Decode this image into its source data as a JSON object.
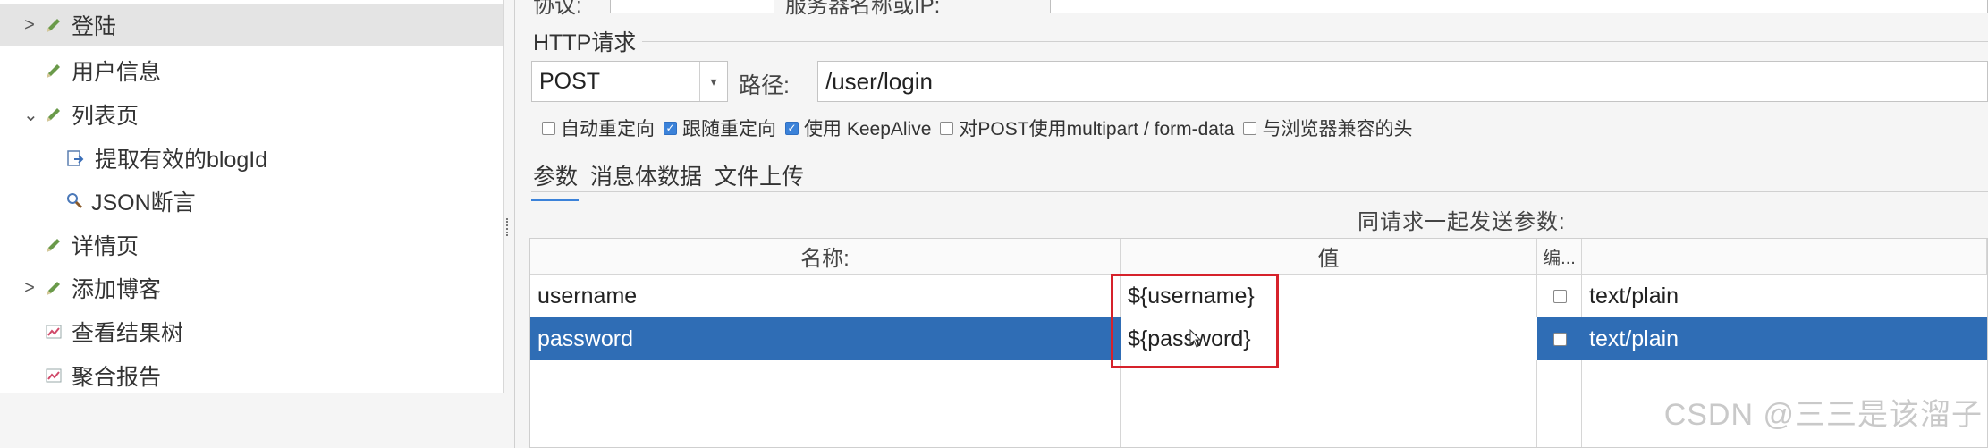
{
  "tree": {
    "items": [
      {
        "label": "登陆",
        "chevron": ">",
        "icon": "pencil-icon",
        "selected": true
      },
      {
        "label": "用户信息",
        "chevron": "",
        "icon": "pencil-icon",
        "selected": false
      },
      {
        "label": "列表页",
        "chevron": "⌄",
        "icon": "pencil-icon",
        "selected": false
      },
      {
        "label": "提取有效的blogId",
        "chevron": "",
        "icon": "extractor-icon",
        "selected": false
      },
      {
        "label": "JSON断言",
        "chevron": "",
        "icon": "magnifier-icon",
        "selected": false
      },
      {
        "label": "详情页",
        "chevron": "",
        "icon": "pencil-icon",
        "selected": false
      },
      {
        "label": "添加博客",
        "chevron": ">",
        "icon": "pencil-icon",
        "selected": false
      },
      {
        "label": "查看结果树",
        "chevron": "",
        "icon": "chart-icon",
        "selected": false
      },
      {
        "label": "聚合报告",
        "chevron": "",
        "icon": "chart-icon",
        "selected": false
      }
    ]
  },
  "top": {
    "protocol_label": "协议:",
    "server_label": "服务器名称或IP:"
  },
  "http": {
    "section_title": "HTTP请求",
    "method": "POST",
    "path_label": "路径:",
    "path_value": "/user/login",
    "options": [
      {
        "label": "自动重定向",
        "checked": false
      },
      {
        "label": "跟随重定向",
        "checked": true
      },
      {
        "label": "使用 KeepAlive",
        "checked": true
      },
      {
        "label": "对POST使用multipart / form-data",
        "checked": false
      },
      {
        "label": "与浏览器兼容的头",
        "checked": false
      }
    ],
    "tabs": [
      {
        "label": "参数",
        "active": true
      },
      {
        "label": "消息体数据",
        "active": false
      },
      {
        "label": "文件上传",
        "active": false
      }
    ]
  },
  "params": {
    "caption": "同请求一起发送参数:",
    "headers": {
      "name": "名称:",
      "value": "值",
      "encode": "编...",
      "content_type": ""
    },
    "rows": [
      {
        "name": "username",
        "value": "${username}",
        "encode": false,
        "content_type": "text/plain",
        "selected": false
      },
      {
        "name": "password",
        "value": "${password}",
        "encode": false,
        "content_type": "text/plain",
        "selected": true
      }
    ]
  },
  "watermark": "CSDN @三三是该溜子",
  "colors": {
    "selection": "#2f6db5",
    "accent": "#3b82d9",
    "highlight_box": "#d6222b"
  }
}
